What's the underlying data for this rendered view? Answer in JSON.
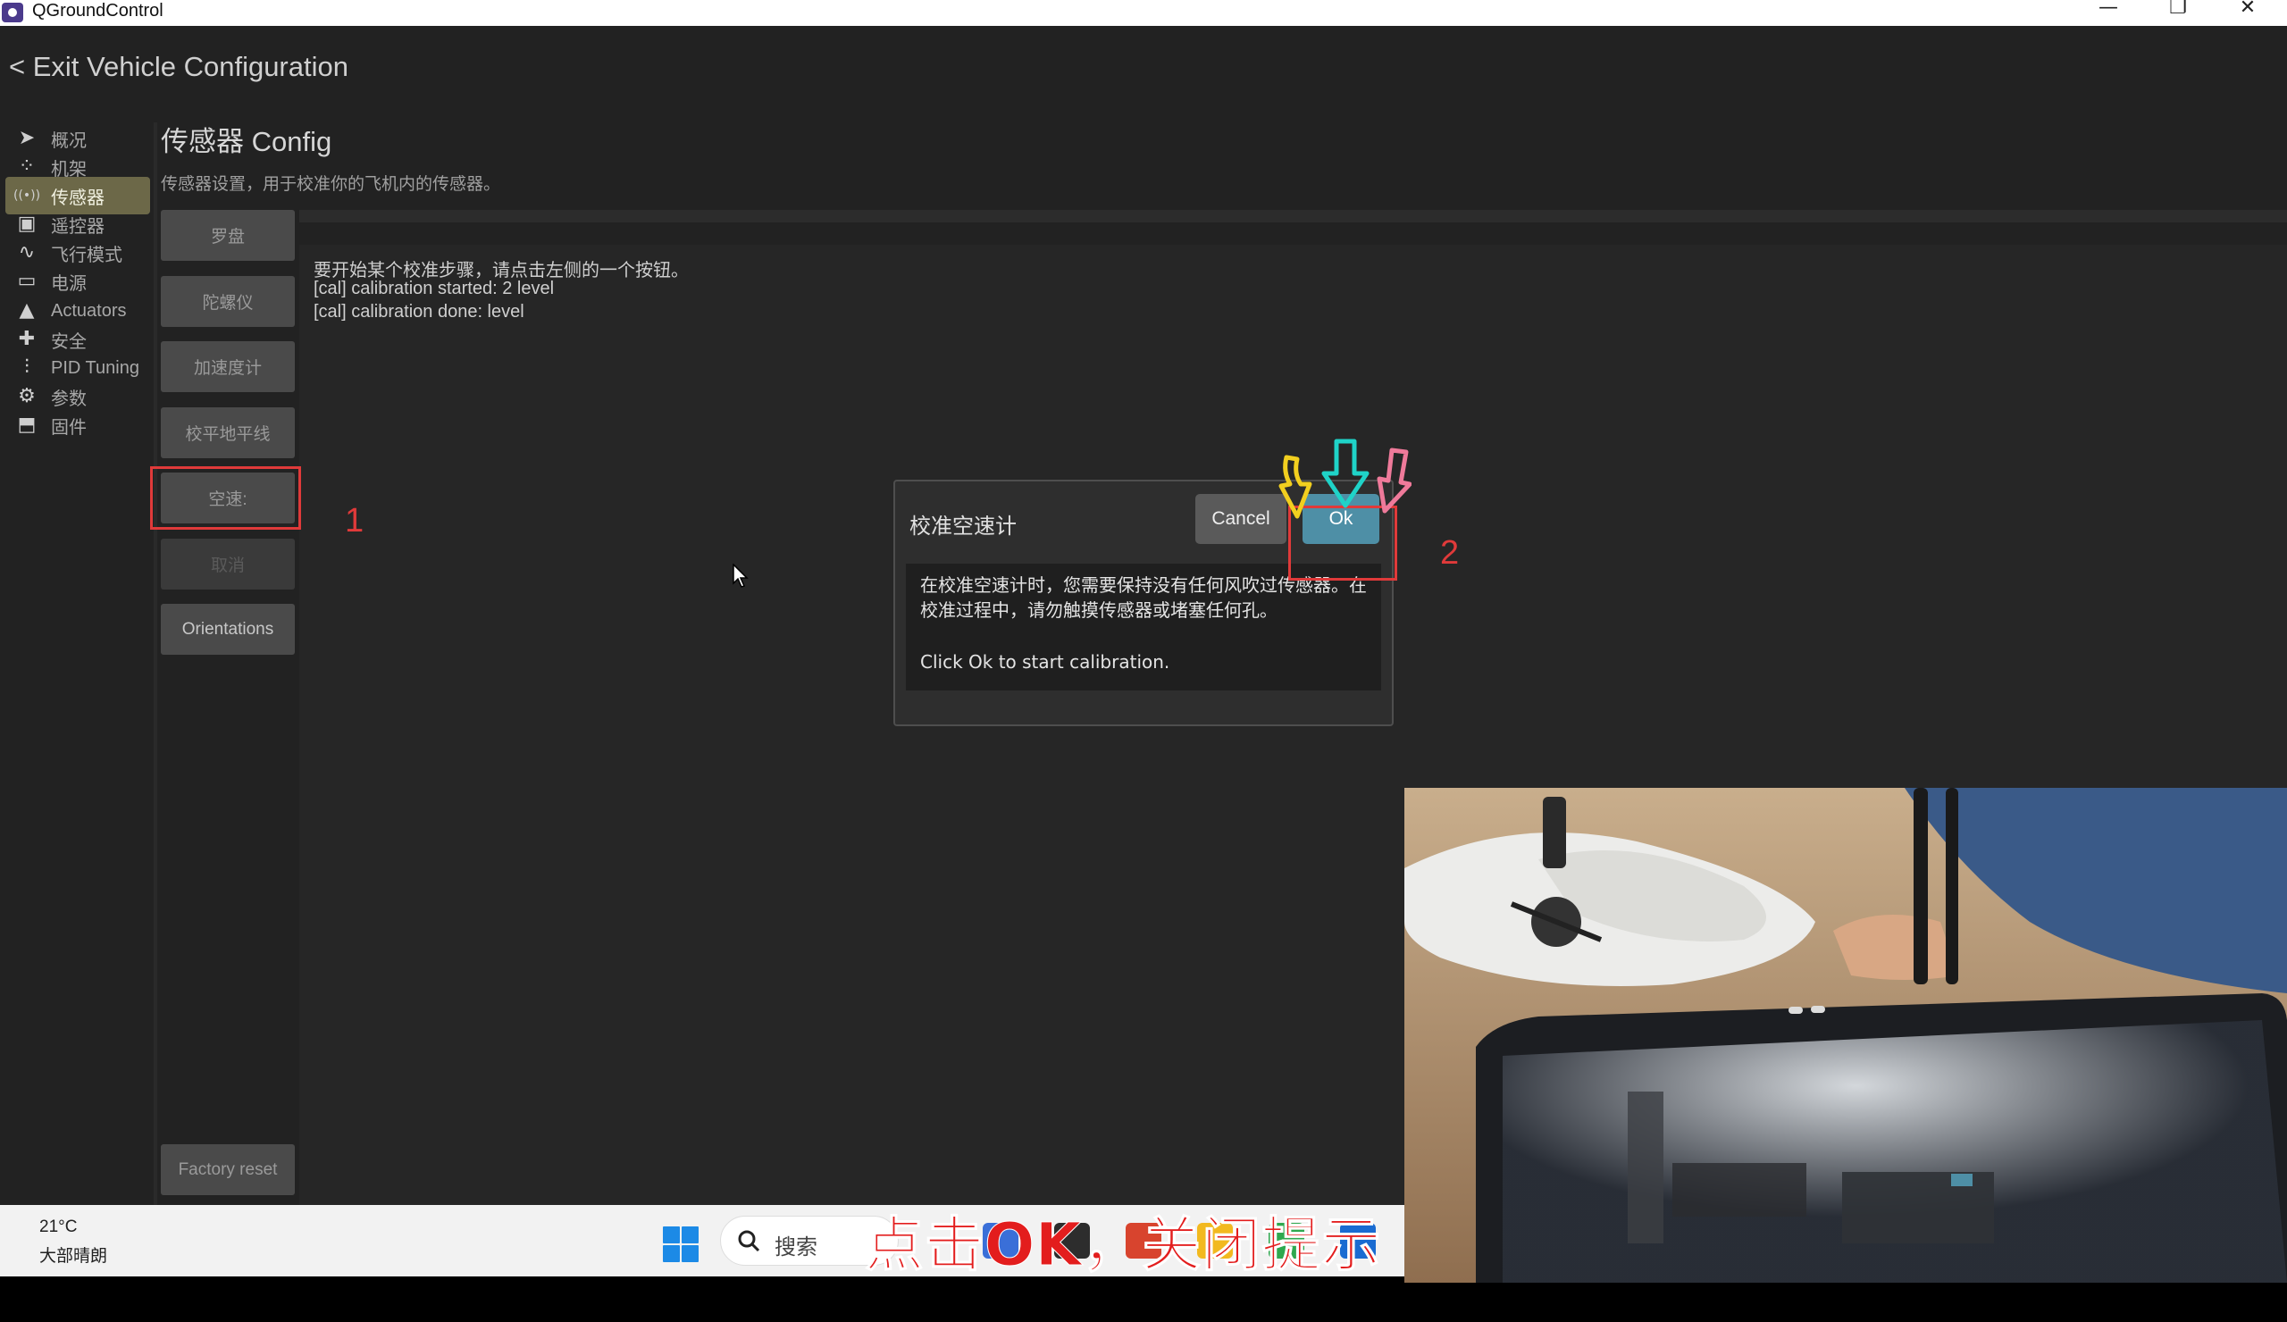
{
  "titlebar": {
    "title": "QGroundControl",
    "controls": {
      "minimize": "—",
      "maximize": "❐",
      "close": "✕"
    }
  },
  "header": {
    "exit_label": "< Exit Vehicle Configuration"
  },
  "nav": {
    "items": [
      {
        "label": "概况",
        "icon": "paper-plane-icon",
        "glyph": "➤"
      },
      {
        "label": "机架",
        "icon": "airframe-icon",
        "glyph": "⁘"
      },
      {
        "label": "传感器",
        "icon": "sensors-icon",
        "glyph": "((•))",
        "active": true
      },
      {
        "label": "遥控器",
        "icon": "radio-controller-icon",
        "glyph": "▣"
      },
      {
        "label": "飞行模式",
        "icon": "flight-modes-icon",
        "glyph": "∿"
      },
      {
        "label": "电源",
        "icon": "battery-icon",
        "glyph": "▭"
      },
      {
        "label": "Actuators",
        "icon": "actuators-icon",
        "glyph": "▲"
      },
      {
        "label": "安全",
        "icon": "safety-icon",
        "glyph": "✚"
      },
      {
        "label": "PID Tuning",
        "icon": "tuning-sliders-icon",
        "glyph": "⫶"
      },
      {
        "label": "参数",
        "icon": "parameters-gear-icon",
        "glyph": "⚙"
      },
      {
        "label": "固件",
        "icon": "firmware-icon",
        "glyph": "⬒"
      }
    ]
  },
  "page": {
    "title": "传感器 Config",
    "description": "传感器设置，用于校准你的飞机内的传感器。"
  },
  "calibration_buttons": [
    {
      "label": "罗盘",
      "state": "normal"
    },
    {
      "label": "陀螺仪",
      "state": "normal"
    },
    {
      "label": "加速度计",
      "state": "normal"
    },
    {
      "label": "校平地平线",
      "state": "normal"
    },
    {
      "label": "空速:",
      "state": "normal"
    },
    {
      "label": "取消",
      "state": "disabled"
    },
    {
      "label": "Orientations",
      "state": "bright"
    }
  ],
  "factory_reset_label": "Factory reset",
  "log": {
    "lines": [
      "要开始某个校准步骤，请点击左侧的一个按钮。",
      "[cal] calibration started: 2 level",
      "[cal] calibration done: level"
    ]
  },
  "annotations": {
    "step1": "1",
    "step2": "2"
  },
  "dialog": {
    "title": "校准空速计",
    "cancel_label": "Cancel",
    "ok_label": "Ok",
    "body_line1": "在校准空速计时，您需要保持没有任何风吹过传感器。在",
    "body_line2": "校准过程中，请勿触摸传感器或堵塞任何孔。",
    "body_line3": "Click Ok to start calibration."
  },
  "taskbar": {
    "temperature": "21°C",
    "weather": "大部晴朗",
    "search_placeholder": "搜索"
  },
  "subtitle_caption": "点击OK，关闭提示",
  "colors": {
    "background": "#222222",
    "active_nav": "#6c6848",
    "ok_button": "#4e8fa6",
    "annotation_red": "#e03a3a",
    "arrow_yellow": "#f2cf1f",
    "arrow_cyan": "#1fd3c8",
    "arrow_pink": "#ef7a9a"
  }
}
